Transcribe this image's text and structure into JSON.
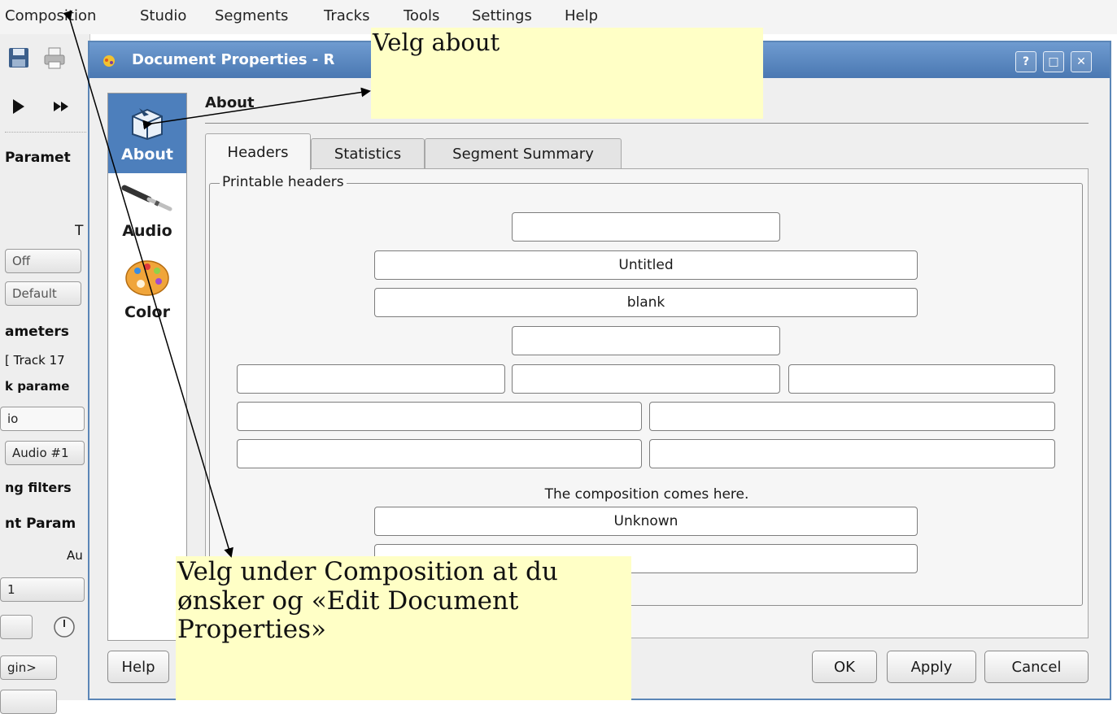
{
  "menubar": {
    "items": [
      "Composition",
      "Studio",
      "Segments",
      "Tracks",
      "Tools",
      "Settings",
      "Help"
    ]
  },
  "background_app": {
    "labels": [
      "Paramet",
      "T",
      "ameters",
      "[ Track 17",
      "k parame",
      "io",
      "ng filters",
      "nt Param",
      "Au"
    ],
    "buttons": [
      "Off",
      "Default",
      "Audio #1",
      "1",
      "gin>"
    ]
  },
  "dialog": {
    "title": "Document Properties - R",
    "window_buttons": [
      "?",
      "□",
      "✕"
    ],
    "pages": [
      "About",
      "Audio",
      "Color"
    ],
    "selected_page": "About",
    "heading": "About",
    "tabs": [
      "Headers",
      "Statistics",
      "Segment Summary"
    ],
    "active_tab": "Headers",
    "groupbox_title": "Printable headers",
    "fields": {
      "dedication": "",
      "title": "Untitled",
      "subtitle": "blank",
      "subsubtitle": "",
      "poet": "",
      "instrument": "",
      "composer": "",
      "meter": "",
      "opus": "",
      "arranger": "",
      "piece": "",
      "copyright": "Unknown",
      "tagline": ""
    },
    "composition_note": "The composition comes here.",
    "buttons": {
      "help": "Help",
      "ok": "OK",
      "apply": "Apply",
      "cancel": "Cancel"
    }
  },
  "annotations": {
    "top_note": "Velg about",
    "bottom_note": "Velg under Composition at du\nønsker og «Edit Document\nProperties»",
    "note_color": "#ffffc6"
  },
  "colors": {
    "titlebar": "#4a78b2",
    "selected_page": "#4d7fbc"
  }
}
